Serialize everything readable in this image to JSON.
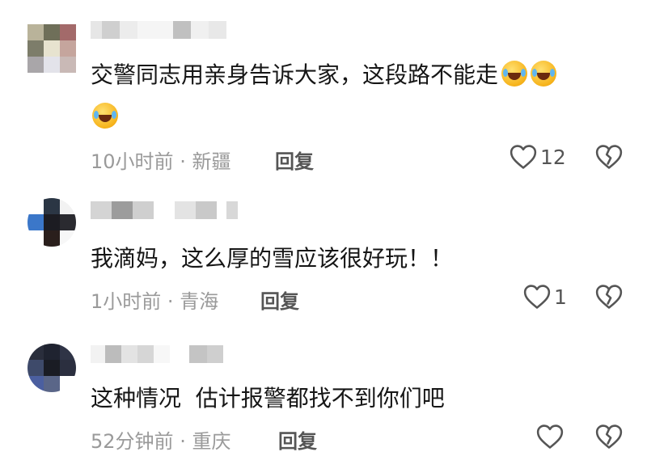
{
  "comments": [
    {
      "text": "交警同志用亲身告诉大家，这段路不能走",
      "time": "10小时前",
      "location": "新疆",
      "reply_label": "回复",
      "like_count": "12"
    },
    {
      "text": "我滴妈，这么厚的雪应该很好玩！！",
      "time": "1小时前",
      "location": "青海",
      "reply_label": "回复",
      "like_count": "1"
    },
    {
      "text": "这种情况  估计报警都找不到你们吧",
      "time": "52分钟前",
      "location": "重庆",
      "reply_label": "回复",
      "like_count": ""
    }
  ],
  "meta_separator": "·",
  "icons": {
    "like": "heart-outline-icon",
    "dislike": "broken-heart-icon",
    "emoji": "rolling-on-floor-laughing-emoji"
  },
  "colors": {
    "text": "#161616",
    "meta": "#9a9a9a",
    "icon": "#555555"
  }
}
